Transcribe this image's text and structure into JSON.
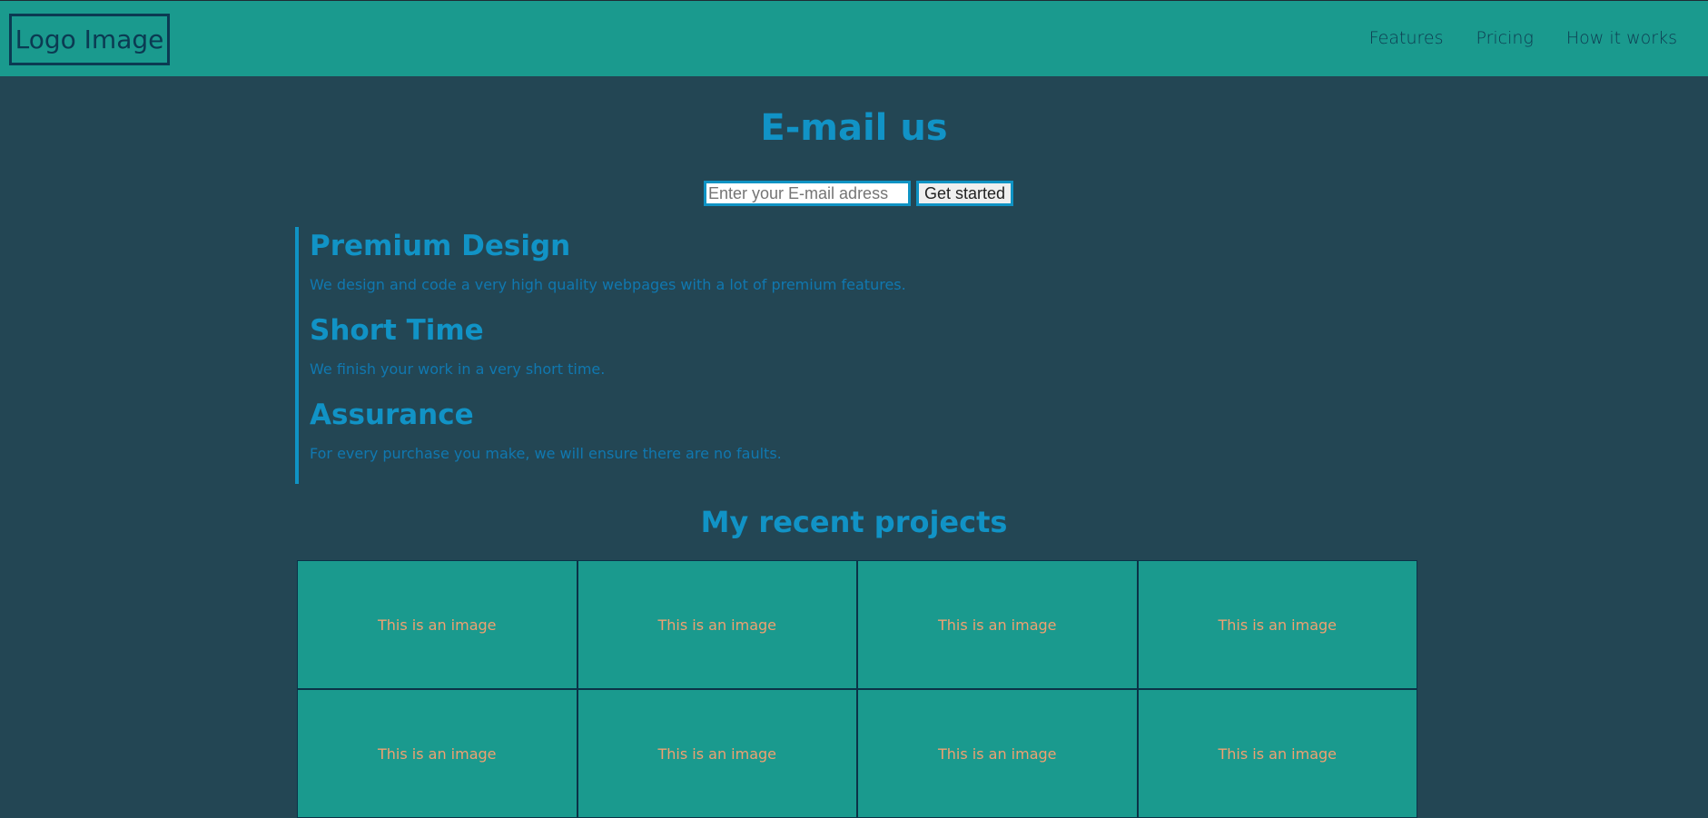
{
  "header": {
    "logo": "Logo Image",
    "nav": [
      "Features",
      "Pricing",
      "How it works"
    ]
  },
  "email": {
    "title": "E-mail us",
    "placeholder": "Enter your E-mail adress",
    "button": "Get started"
  },
  "features": [
    {
      "title": "Premium Design",
      "text": "We design and code a very high quality webpages with a lot of premium features."
    },
    {
      "title": "Short Time",
      "text": "We finish your work in a very short time."
    },
    {
      "title": "Assurance",
      "text": "For every purchase you make, we will ensure there are no faults."
    }
  ],
  "projects": {
    "title": "My recent projects",
    "items": [
      "This is an image",
      "This is an image",
      "This is an image",
      "This is an image",
      "This is an image",
      "This is an image",
      "This is an image",
      "This is an image"
    ]
  }
}
